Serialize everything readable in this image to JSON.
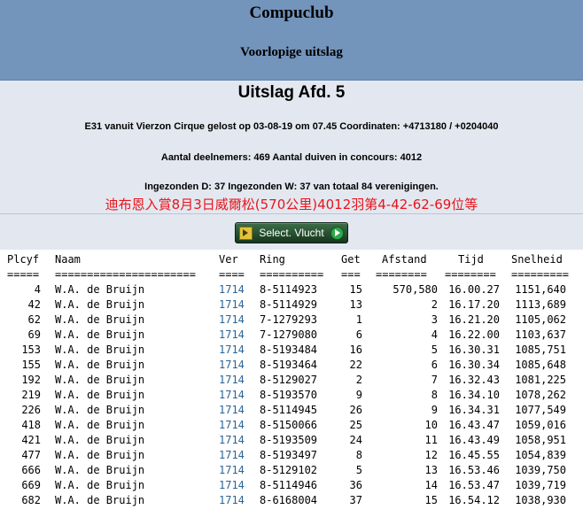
{
  "header": {
    "title": "Compuclub",
    "subtitle": "Voorlopige uitslag"
  },
  "info": {
    "heading": "Uitslag Afd. 5",
    "release_line": "E31 vanuit Vierzon Cirque gelost op 03-08-19 om 07.45 Coordinaten: +4713180 / +0204040",
    "participants_line": "Aantal deelnemers: 469 Aantal duiven in concours: 4012",
    "submitted_line": "Ingezonden D: 37 Ingezonden W: 37 van totaal 84 verenigingen.",
    "chinese_note": "迪布恩入賞8月3日威爾松(570公里)4012羽第4-42-62-69位等"
  },
  "button": {
    "label": "Select. Vlucht"
  },
  "table": {
    "columns": {
      "plcyf": "Plcyf",
      "naam": "Naam",
      "ver": "Ver",
      "ring": "Ring",
      "get": "Get",
      "afstand": "Afstand",
      "tijd": "Tijd",
      "snelheid": "Snelheid"
    },
    "separators": {
      "plcyf": "=====",
      "naam": "======================",
      "ver": "====",
      "ring": "==========",
      "get": "===",
      "afstand": "========",
      "tijd": "========",
      "snelheid": "========="
    },
    "rows": [
      {
        "plcyf": "4",
        "naam": "W.A. de Bruijn",
        "ver": "1714",
        "ring": "8-5114923",
        "get": "15",
        "afstand": "570,580",
        "tijd": "16.00.27",
        "snelheid": "1151,640"
      },
      {
        "plcyf": "42",
        "naam": "W.A. de Bruijn",
        "ver": "1714",
        "ring": "8-5114929",
        "get": "13",
        "afstand": "2",
        "tijd": "16.17.20",
        "snelheid": "1113,689"
      },
      {
        "plcyf": "62",
        "naam": "W.A. de Bruijn",
        "ver": "1714",
        "ring": "7-1279293",
        "get": "1",
        "afstand": "3",
        "tijd": "16.21.20",
        "snelheid": "1105,062"
      },
      {
        "plcyf": "69",
        "naam": "W.A. de Bruijn",
        "ver": "1714",
        "ring": "7-1279080",
        "get": "6",
        "afstand": "4",
        "tijd": "16.22.00",
        "snelheid": "1103,637"
      },
      {
        "plcyf": "153",
        "naam": "W.A. de Bruijn",
        "ver": "1714",
        "ring": "8-5193484",
        "get": "16",
        "afstand": "5",
        "tijd": "16.30.31",
        "snelheid": "1085,751"
      },
      {
        "plcyf": "155",
        "naam": "W.A. de Bruijn",
        "ver": "1714",
        "ring": "8-5193464",
        "get": "22",
        "afstand": "6",
        "tijd": "16.30.34",
        "snelheid": "1085,648"
      },
      {
        "plcyf": "192",
        "naam": "W.A. de Bruijn",
        "ver": "1714",
        "ring": "8-5129027",
        "get": "2",
        "afstand": "7",
        "tijd": "16.32.43",
        "snelheid": "1081,225"
      },
      {
        "plcyf": "219",
        "naam": "W.A. de Bruijn",
        "ver": "1714",
        "ring": "8-5193570",
        "get": "9",
        "afstand": "8",
        "tijd": "16.34.10",
        "snelheid": "1078,262"
      },
      {
        "plcyf": "226",
        "naam": "W.A. de Bruijn",
        "ver": "1714",
        "ring": "8-5114945",
        "get": "26",
        "afstand": "9",
        "tijd": "16.34.31",
        "snelheid": "1077,549"
      },
      {
        "plcyf": "418",
        "naam": "W.A. de Bruijn",
        "ver": "1714",
        "ring": "8-5150066",
        "get": "25",
        "afstand": "10",
        "tijd": "16.43.47",
        "snelheid": "1059,016"
      },
      {
        "plcyf": "421",
        "naam": "W.A. de Bruijn",
        "ver": "1714",
        "ring": "8-5193509",
        "get": "24",
        "afstand": "11",
        "tijd": "16.43.49",
        "snelheid": "1058,951"
      },
      {
        "plcyf": "477",
        "naam": "W.A. de Bruijn",
        "ver": "1714",
        "ring": "8-5193497",
        "get": "8",
        "afstand": "12",
        "tijd": "16.45.55",
        "snelheid": "1054,839"
      },
      {
        "plcyf": "666",
        "naam": "W.A. de Bruijn",
        "ver": "1714",
        "ring": "8-5129102",
        "get": "5",
        "afstand": "13",
        "tijd": "16.53.46",
        "snelheid": "1039,750"
      },
      {
        "plcyf": "669",
        "naam": "W.A. de Bruijn",
        "ver": "1714",
        "ring": "8-5114946",
        "get": "36",
        "afstand": "14",
        "tijd": "16.53.47",
        "snelheid": "1039,719"
      },
      {
        "plcyf": "682",
        "naam": "W.A. de Bruijn",
        "ver": "1714",
        "ring": "8-6168004",
        "get": "37",
        "afstand": "15",
        "tijd": "16.54.12",
        "snelheid": "1038,930"
      }
    ]
  }
}
